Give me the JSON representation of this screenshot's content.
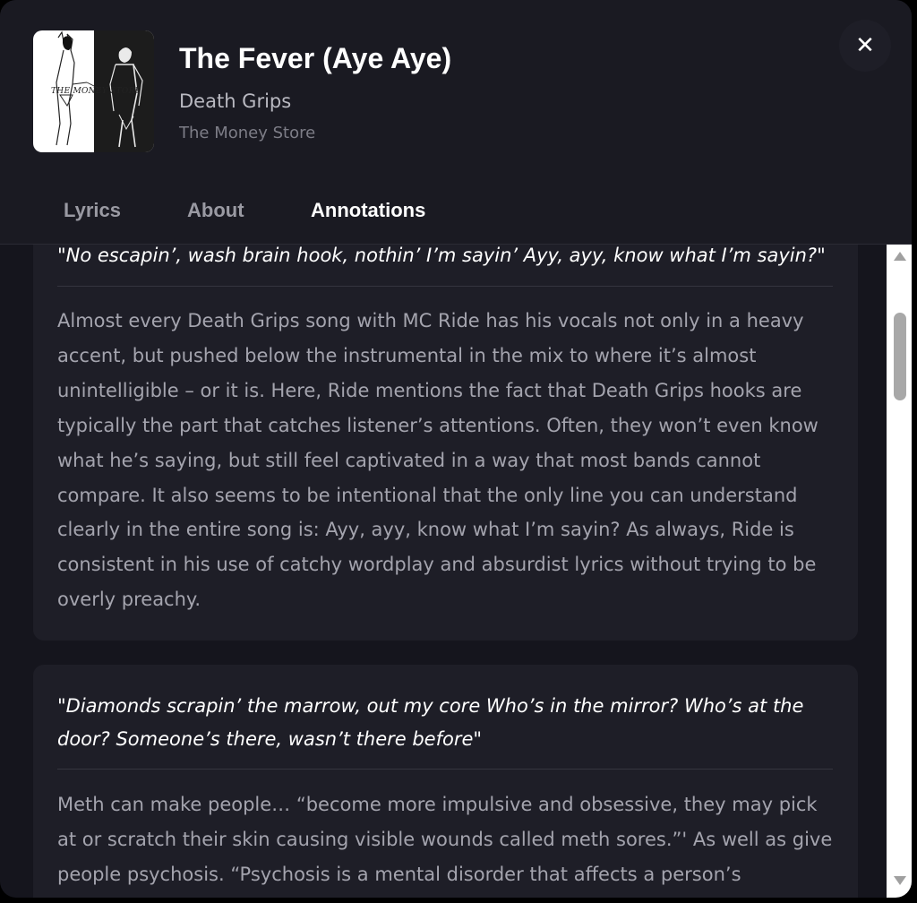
{
  "track": {
    "title": "The Fever (Aye Aye)",
    "artist": "Death Grips",
    "album": "The Money Store",
    "cover_text": "THE MONEY STORE"
  },
  "close": {
    "label": "✕"
  },
  "tabs": [
    {
      "label": "Lyrics",
      "active": false
    },
    {
      "label": "About",
      "active": false
    },
    {
      "label": "Annotations",
      "active": true
    }
  ],
  "annotations": [
    {
      "quote": "\"No escapin’, wash brain hook, nothin’ I’m sayin’ Ayy, ayy, know what I’m sayin?\"",
      "body": "Almost every Death Grips song with MC Ride has his vocals not only in a heavy accent, but pushed below the instrumental in the mix to where it’s almost unintelligible – or it is. Here, Ride mentions the fact that Death Grips hooks are typically the part that catches listener’s attentions. Often, they won’t even know what he’s saying, but still feel captivated in a way that most bands cannot compare. It also seems to be intentional that the only line you can understand clearly in the entire song is: Ayy, ayy, know what I’m sayin? As always, Ride is consistent in his use of catchy wordplay and absurdist lyrics without trying to be overly preachy."
    },
    {
      "quote": "\"Diamonds scrapin’ the marrow, out my core Who’s in the mirror? Who’s at the door? Someone’s there, wasn’t there before\"",
      "body": "Meth can make people… “become more impulsive and obsessive, they may pick at or scratch their skin causing visible wounds called meth sores.”' As well as give people psychosis. “Psychosis is a mental disorder that affects a person’s"
    }
  ],
  "colors": {
    "background": "#15151d",
    "header": "#1a1a22",
    "card": "#1e1e27",
    "text_primary": "#ffffff",
    "text_secondary": "#a4a4ae"
  }
}
